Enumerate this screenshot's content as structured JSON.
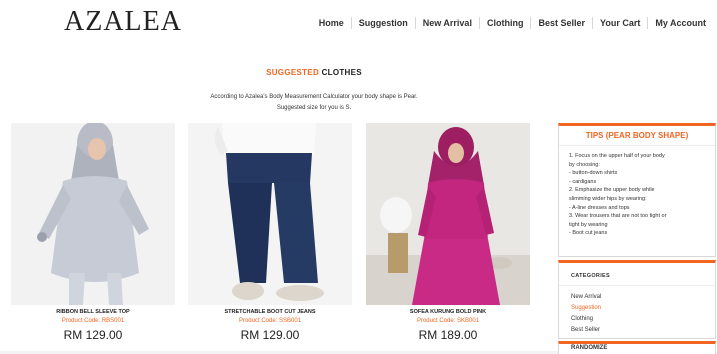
{
  "brand": "AZALEA",
  "nav": [
    "Home",
    "Suggestion",
    "New Arrival",
    "Clothing",
    "Best Seller",
    "Your Cart",
    "My Account"
  ],
  "section": {
    "accent": "SUGGESTED",
    "rest": "CLOTHES"
  },
  "intro": {
    "line1": "According to Azalea's Body Measurement Calculator your body shape is Pear.",
    "line2": "Suggested size for you is S."
  },
  "products": [
    {
      "name": "RIBBON BELL SLEEVE TOP",
      "code": "Product Code: RBS001",
      "price": "RM 129.00"
    },
    {
      "name": "STRETCHABLE BOOT CUT JEANS",
      "code": "Product Code: SSB001",
      "price": "RM 129.00"
    },
    {
      "name": "SOFEA KURUNG BOLD PINK",
      "code": "Product Code: SKB001",
      "price": "RM 189.00"
    }
  ],
  "tips": {
    "title": "TIPS (PEAR BODY SHAPE)",
    "lines": [
      "1. Focus on the upper half of your body",
      "by choosing:",
      "- button-down shirts",
      "- cardigans",
      "2. Emphasize the upper body while",
      "slimming wider hips by wearing:",
      "- A-line dresses and tops",
      "3. Wear trousers that are not too tight or",
      "tight by wearing",
      "- Boot cut jeans"
    ]
  },
  "categories": {
    "title": "CATEGORIES",
    "items": [
      "New Arrival",
      "Suggestion",
      "Clothing",
      "Best Seller"
    ],
    "active": "Suggestion"
  },
  "random": {
    "title": "RANDOMIZE"
  },
  "colors": {
    "accent": "#f26522"
  }
}
